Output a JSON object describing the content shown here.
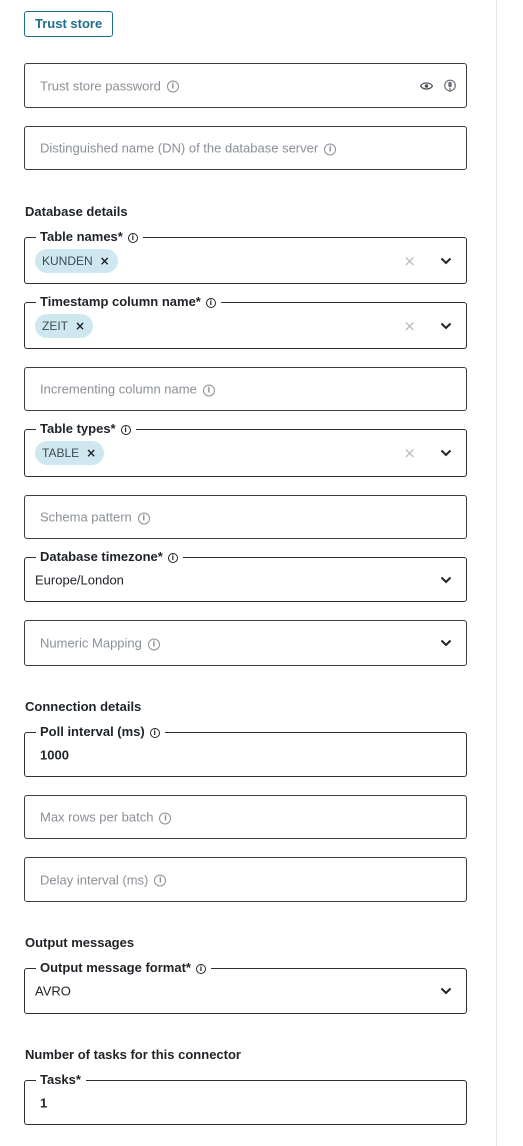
{
  "trust_store_button": "Trust store",
  "fields": {
    "trust_store_password": {
      "placeholder": "Trust store password"
    },
    "distinguished_name": {
      "placeholder": "Distinguished name (DN) of the database server"
    },
    "table_names": {
      "label": "Table names*",
      "chip": "KUNDEN"
    },
    "timestamp_column": {
      "label": "Timestamp column name*",
      "chip": "ZEIT"
    },
    "incrementing_column": {
      "placeholder": "Incrementing column name"
    },
    "table_types": {
      "label": "Table types*",
      "chip": "TABLE"
    },
    "schema_pattern": {
      "placeholder": "Schema pattern"
    },
    "database_timezone": {
      "label": "Database timezone*",
      "value": "Europe/London"
    },
    "numeric_mapping": {
      "placeholder": "Numeric Mapping"
    },
    "poll_interval": {
      "label": "Poll interval (ms)",
      "value": "1000"
    },
    "max_rows_per_batch": {
      "placeholder": "Max rows per batch"
    },
    "delay_interval": {
      "placeholder": "Delay interval (ms)"
    },
    "output_message_format": {
      "label": "Output message format*",
      "value": "AVRO"
    },
    "tasks": {
      "label": "Tasks*",
      "value": "1"
    }
  },
  "sections": {
    "database_details": "Database details",
    "connection_details": "Connection details",
    "output_messages": "Output messages",
    "number_of_tasks": "Number of tasks for this connector"
  },
  "glyphs": {
    "info": "i",
    "remove": "×",
    "clear": "×"
  },
  "icons": [
    "info-icon",
    "eye-icon",
    "microphone-icon",
    "chevron-down-icon",
    "close-icon"
  ]
}
